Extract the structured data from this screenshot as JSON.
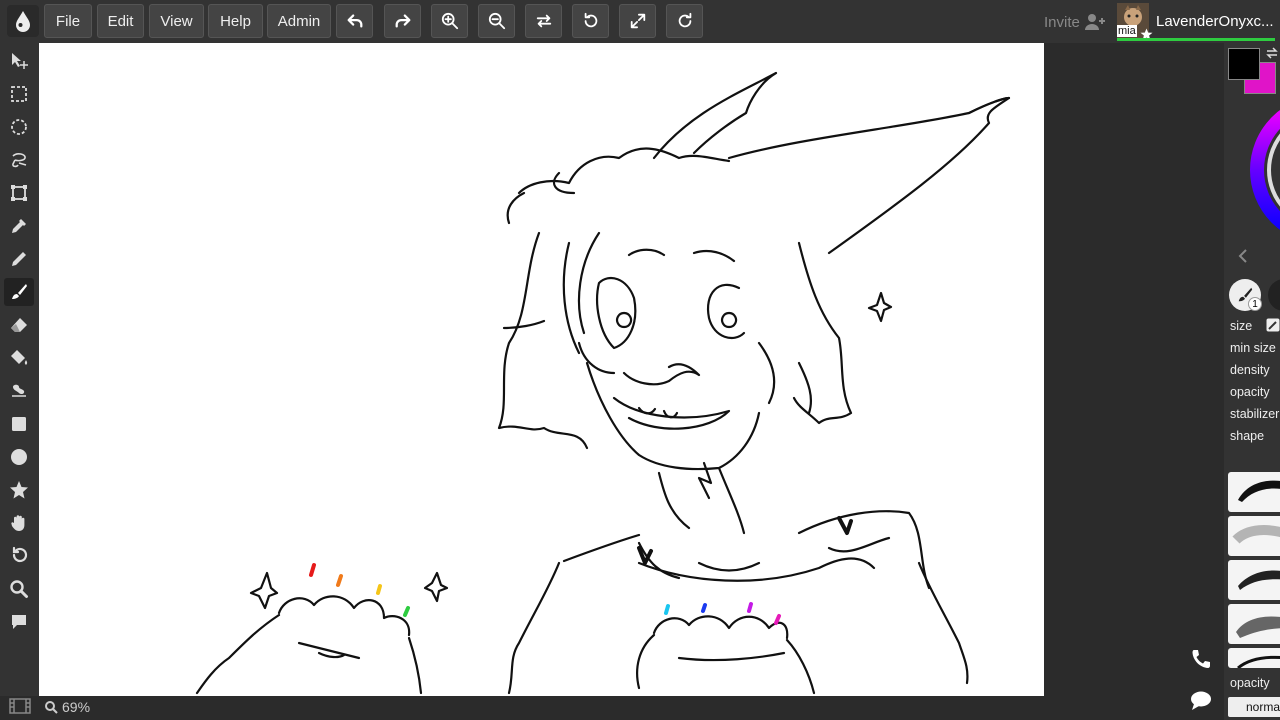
{
  "app": {
    "menu": [
      "File",
      "Edit",
      "View",
      "Help",
      "Admin"
    ]
  },
  "toolbar_icons": [
    "undo-icon",
    "redo-icon",
    "zoom-in-icon",
    "zoom-out-icon",
    "flip-icon",
    "rotate-left-icon",
    "fullscreen-icon",
    "rotate-right-icon"
  ],
  "user": {
    "invite_label": "Invite",
    "avatar_label": "mia",
    "name": "LavenderOnyxc..."
  },
  "tools": [
    "move-tool",
    "rect-select-tool",
    "ellipse-select-tool",
    "lasso-select-tool",
    "transform-tool",
    "eyedropper-tool",
    "pencil-tool",
    "brush-tool",
    "eraser-tool",
    "fill-tool",
    "smudge-tool",
    "rectangle-tool",
    "ellipse-tool",
    "shape-tool",
    "hand-tool",
    "rotate-tool",
    "zoom-tool",
    "comment-tool"
  ],
  "active_tool": "brush-tool",
  "status": {
    "zoom": "69%"
  },
  "colors": {
    "primary": "#000000",
    "secondary": "#e014c8"
  },
  "brush": {
    "badge": "1",
    "properties": [
      "size",
      "min size",
      "density",
      "opacity",
      "stabilizer",
      "shape"
    ]
  },
  "layer": {
    "opacity_label": "opacity",
    "blend_mode": "normal"
  }
}
